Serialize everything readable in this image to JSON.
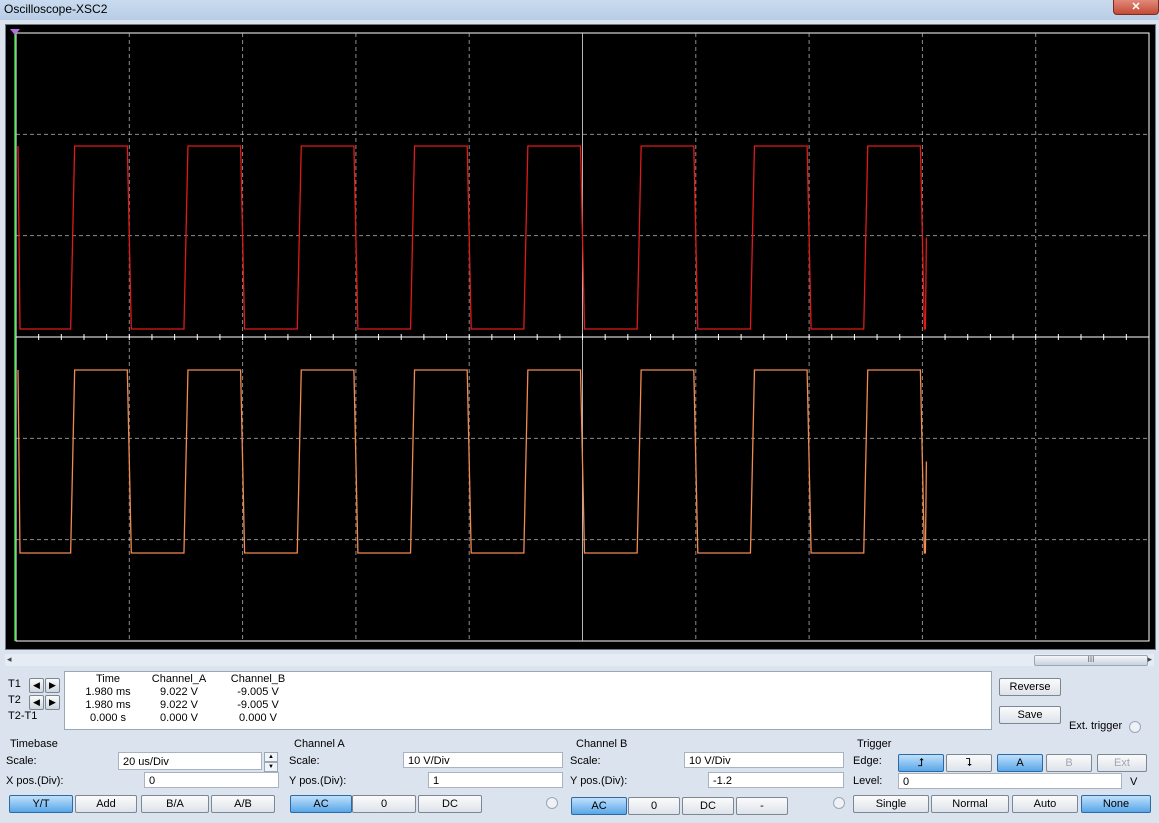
{
  "window": {
    "title": "Oscilloscope-XSC2",
    "close_label": "✕"
  },
  "readout": {
    "row_labels": [
      "T1",
      "T2",
      "T2-T1"
    ],
    "headers": {
      "time": "Time",
      "channel_a": "Channel_A",
      "channel_b": "Channel_B"
    },
    "rows": [
      {
        "time": "1.980 ms",
        "channel_a": "9.022 V",
        "channel_b": "-9.005 V"
      },
      {
        "time": "1.980 ms",
        "channel_a": "9.022 V",
        "channel_b": "-9.005 V"
      },
      {
        "time": "0.000 s",
        "channel_a": "0.000 V",
        "channel_b": "0.000 V"
      }
    ]
  },
  "buttons": {
    "reverse": "Reverse",
    "save": "Save",
    "ext_trigger": "Ext. trigger"
  },
  "timebase": {
    "title": "Timebase",
    "scale_label": "Scale:",
    "scale_value": "20 us/Div",
    "xpos_label": "X pos.(Div):",
    "xpos_value": "0",
    "modes": [
      "Y/T",
      "Add",
      "B/A",
      "A/B"
    ]
  },
  "channel_a": {
    "title": "Channel A",
    "scale_label": "Scale:",
    "scale_value": "10  V/Div",
    "ypos_label": "Y pos.(Div):",
    "ypos_value": "1",
    "coupling": [
      "AC",
      "0",
      "DC"
    ]
  },
  "channel_b": {
    "title": "Channel B",
    "scale_label": "Scale:",
    "scale_value": "10  V/Div",
    "ypos_label": "Y pos.(Div):",
    "ypos_value": "-1.2",
    "coupling": [
      "AC",
      "0",
      "DC",
      "-"
    ]
  },
  "trigger": {
    "title": "Trigger",
    "edge_label": "Edge:",
    "edge_rising": "⮥",
    "edge_falling": "⮧",
    "source": [
      "A",
      "B",
      "Ext"
    ],
    "level_label": "Level:",
    "level_value": "0",
    "level_unit": "V",
    "modes": [
      "Single",
      "Normal",
      "Auto",
      "None"
    ]
  },
  "scroll_thumb": "III",
  "colors": {
    "channel_a_trace": "#e01a1a",
    "channel_b_trace": "#f08a50",
    "grid": "#c8c8c8",
    "screen": "#000000"
  }
}
